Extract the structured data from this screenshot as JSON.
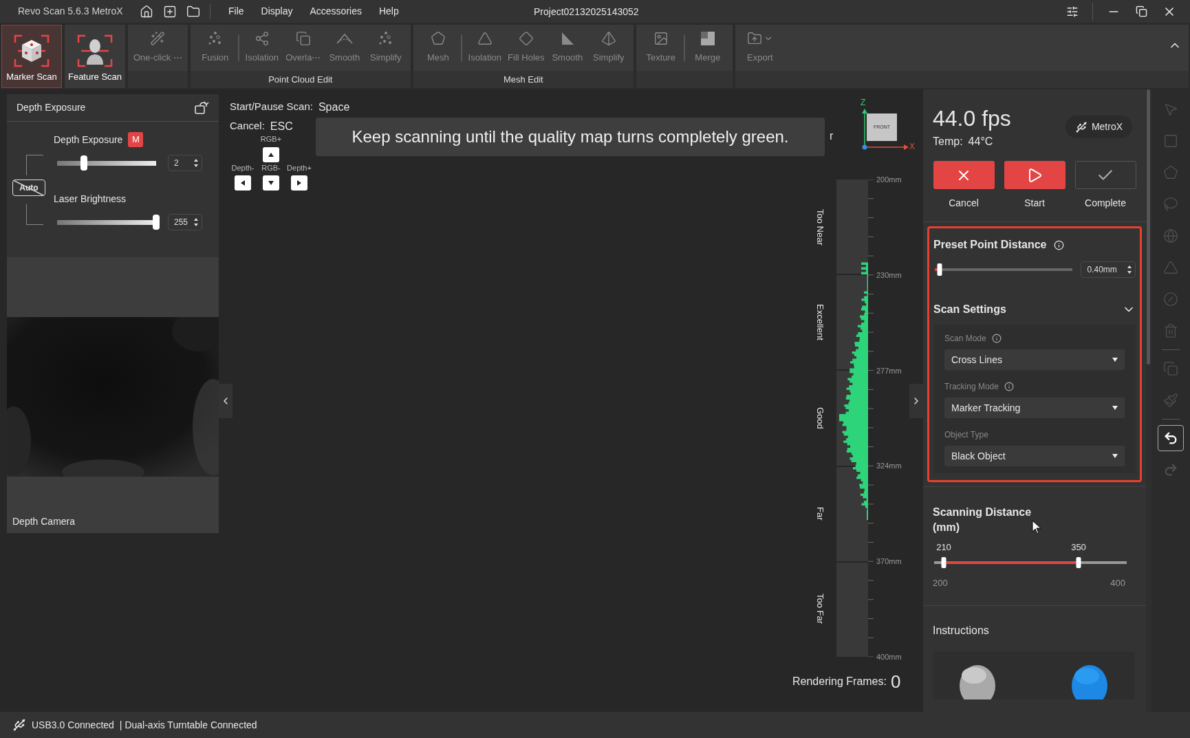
{
  "title_bar": {
    "app_name": "Revo Scan 5.6.3 MetroX",
    "menu": [
      "File",
      "Display",
      "Accessories",
      "Help"
    ],
    "project": "Project02132025143052"
  },
  "ribbon": {
    "scan_modes": [
      {
        "label": "Marker Scan",
        "kind": "marker",
        "selected": true
      },
      {
        "label": "Feature Scan",
        "kind": "feature",
        "selected": false
      }
    ],
    "groups": [
      {
        "tools": [
          {
            "label": "One-click ⋯",
            "kind": "wand",
            "disabled": true
          }
        ]
      },
      {
        "label": "Point Cloud Edit",
        "tools": [
          {
            "label": "Fusion",
            "kind": "fusion",
            "disabled": true
          },
          {
            "kind": "divider"
          },
          {
            "label": "Isolation",
            "kind": "isolation",
            "disabled": true
          },
          {
            "label": "Overla⋯",
            "kind": "overlap",
            "disabled": true
          },
          {
            "label": "Smooth",
            "kind": "smooth",
            "disabled": true
          },
          {
            "label": "Simplify",
            "kind": "simplify",
            "disabled": true
          }
        ]
      },
      {
        "label": "Mesh Edit",
        "tools": [
          {
            "label": "Mesh",
            "kind": "mesh",
            "disabled": true
          },
          {
            "kind": "divider"
          },
          {
            "label": "Isolation",
            "kind": "mesh_isolation",
            "disabled": true
          },
          {
            "label": "Fill Holes",
            "kind": "fill_holes",
            "disabled": true
          },
          {
            "label": "Smooth",
            "kind": "ramp",
            "disabled": true
          },
          {
            "label": "Simplify",
            "kind": "pyramid",
            "disabled": true
          }
        ]
      },
      {
        "tools": [
          {
            "label": "Texture",
            "kind": "texture",
            "disabled": true
          },
          {
            "kind": "divider"
          },
          {
            "label": "Merge",
            "kind": "merge",
            "disabled": true
          }
        ]
      },
      {
        "tools": [
          {
            "label": "Export",
            "kind": "export",
            "disabled": true
          }
        ]
      }
    ]
  },
  "exposure_panel": {
    "title": "Depth Exposure",
    "auto_label": "Auto",
    "auto_enabled": false,
    "sliders": [
      {
        "label": "Depth Exposure",
        "badge": "M",
        "level": 0.27,
        "value": "2"
      },
      {
        "label": "Laser Brightness",
        "level": 1,
        "value": "255"
      }
    ],
    "camera_label": "Depth Camera"
  },
  "viewport": {
    "shortcuts": [
      {
        "label": "Start/Pause Scan:",
        "key": "Space"
      },
      {
        "label": "Cancel:",
        "key": "ESC"
      }
    ],
    "arrow_keys": [
      {
        "label": "RGB+",
        "kind": "up"
      },
      {
        "label": "Depth-",
        "kind": "left"
      },
      {
        "label": "RGB-",
        "kind": "down"
      },
      {
        "label": "Depth+",
        "kind": "right"
      }
    ],
    "banner": "Keep scanning until the quality map turns completely green.",
    "hidden_hint": "r",
    "axis": {
      "z": "Z",
      "x": "X",
      "cube": "FRONT"
    },
    "distance_gauge": {
      "zones": [
        "Too Near",
        "Excellent",
        "Good",
        "Far",
        "Too Far"
      ],
      "ticks": [
        "200mm",
        "230mm",
        "277mm",
        "324mm",
        "370mm",
        "400mm"
      ]
    },
    "rendering_frames": {
      "label": "Rendering Frames:",
      "value": "0"
    }
  },
  "scan_panel": {
    "fps": "44.0 fps",
    "temp_label": "Temp:",
    "temp": "44°C",
    "device": "MetroX",
    "actions": [
      {
        "label": "Cancel",
        "kind": "cancel",
        "disabled": false
      },
      {
        "label": "Start",
        "kind": "start",
        "disabled": false
      },
      {
        "label": "Complete",
        "kind": "complete",
        "disabled": true
      }
    ],
    "preset": {
      "title": "Preset Point Distance",
      "level": 0.03,
      "value": "0.40mm",
      "highlighted": true
    },
    "scan_settings": {
      "title": "Scan Settings",
      "expanded": true,
      "fields": [
        {
          "label": "Scan Mode",
          "info": true,
          "value": "Cross Lines"
        },
        {
          "label": "Tracking Mode",
          "info": true,
          "value": "Marker Tracking"
        },
        {
          "label": "Object Type",
          "info": false,
          "value": "Black Object"
        }
      ]
    },
    "scanning_distance": {
      "title": "Scanning Distance (mm)",
      "thumbs": [
        {
          "label": "210",
          "level": 0.05
        },
        {
          "label": "350",
          "level": 0.75
        }
      ],
      "min": "200",
      "max": "400"
    },
    "instructions": {
      "title": "Instructions"
    }
  },
  "tool_strip": [
    {
      "kind": "pointer",
      "disabled": true
    },
    {
      "kind": "rect",
      "disabled": true
    },
    {
      "kind": "polygon",
      "disabled": true
    },
    {
      "kind": "lasso",
      "disabled": true
    },
    {
      "kind": "sphere",
      "disabled": true
    },
    {
      "kind": "triangle",
      "disabled": true
    },
    {
      "kind": "slash",
      "disabled": true
    },
    {
      "kind": "trash",
      "disabled": true
    },
    {
      "kind": "divider"
    },
    {
      "kind": "copy",
      "disabled": true
    },
    {
      "kind": "brush",
      "disabled": true
    },
    {
      "kind": "divider"
    },
    {
      "kind": "undo",
      "disabled": false
    },
    {
      "kind": "redo",
      "disabled": true
    }
  ],
  "status_bar": {
    "usb": "USB3.0 Connected",
    "turntable": "| Dual-axis Turntable Connected"
  }
}
